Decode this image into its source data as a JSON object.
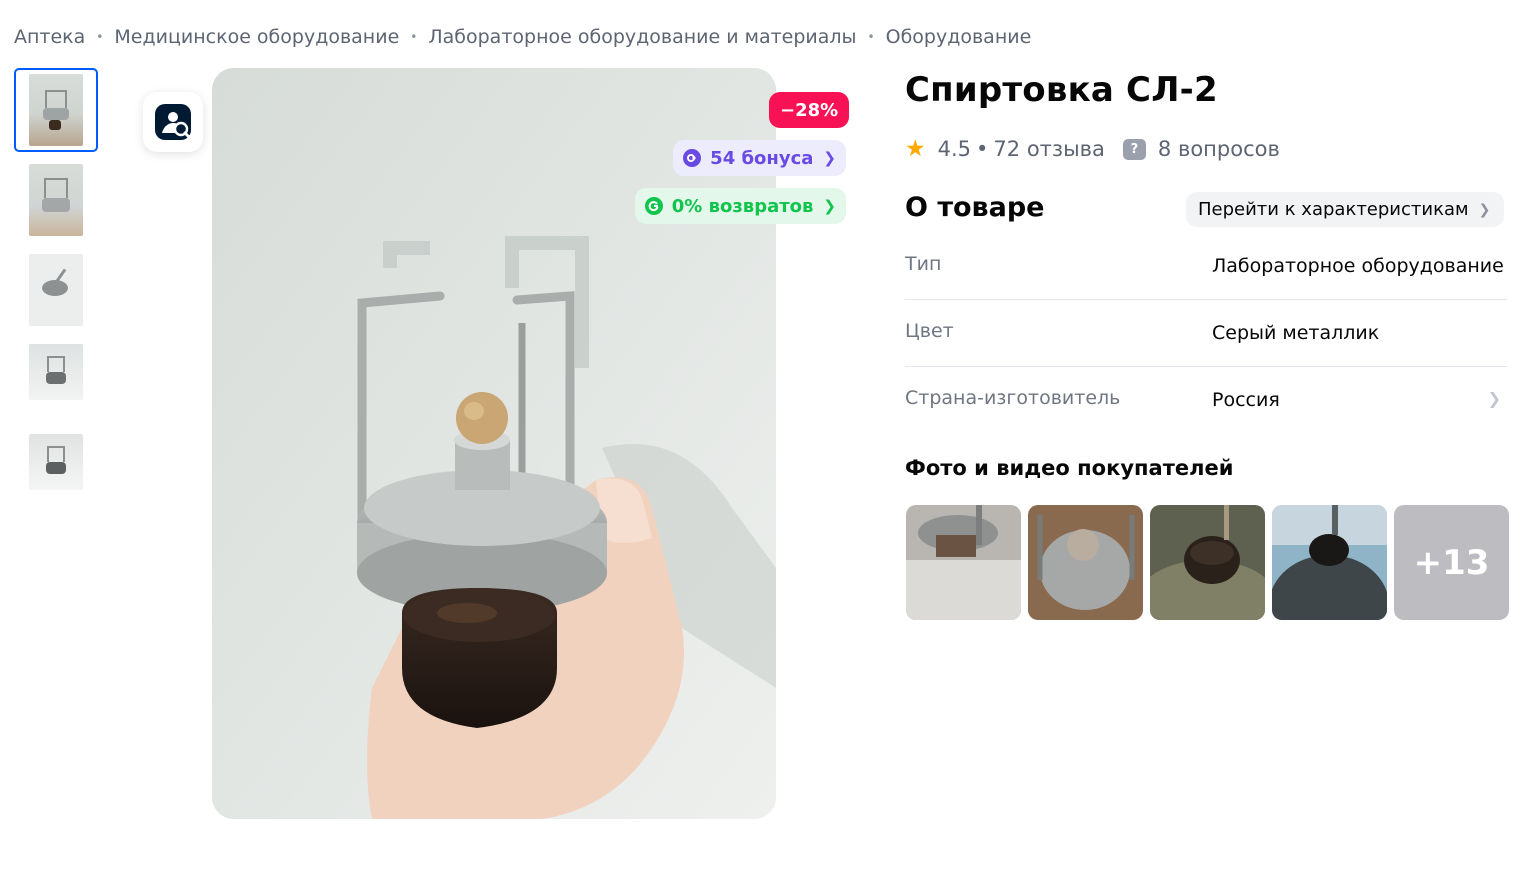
{
  "breadcrumb": {
    "items": [
      "Аптека",
      "Медицинское оборудование",
      "Лабораторное оборудование и материалы",
      "Оборудование"
    ],
    "separator": "•"
  },
  "gallery": {
    "thumbnail_count": 5,
    "active_index": 0
  },
  "badges": {
    "discount": "−28%",
    "bonus": "54 бонуса",
    "returns": "0% возвратов"
  },
  "product": {
    "title": "Спиртовка СЛ-2",
    "rating": "4.5",
    "reviews": "72 отзыва",
    "questions": "8 вопросов"
  },
  "about": {
    "title": "О товаре",
    "specs_link": "Перейти к характеристикам",
    "specs": [
      {
        "key": "Тип",
        "value": "Лабораторное оборудование"
      },
      {
        "key": "Цвет",
        "value": "Серый металлик"
      },
      {
        "key": "Страна-изготовитель",
        "value": "Россия"
      }
    ]
  },
  "ugc": {
    "title": "Фото и видео покупателей",
    "more": "+13"
  },
  "colors": {
    "accent_blue": "#005bff",
    "discount_pink": "#f91155",
    "bonus_purple": "#6a4ae4",
    "returns_green": "#10c44c",
    "star": "#ffa800"
  }
}
